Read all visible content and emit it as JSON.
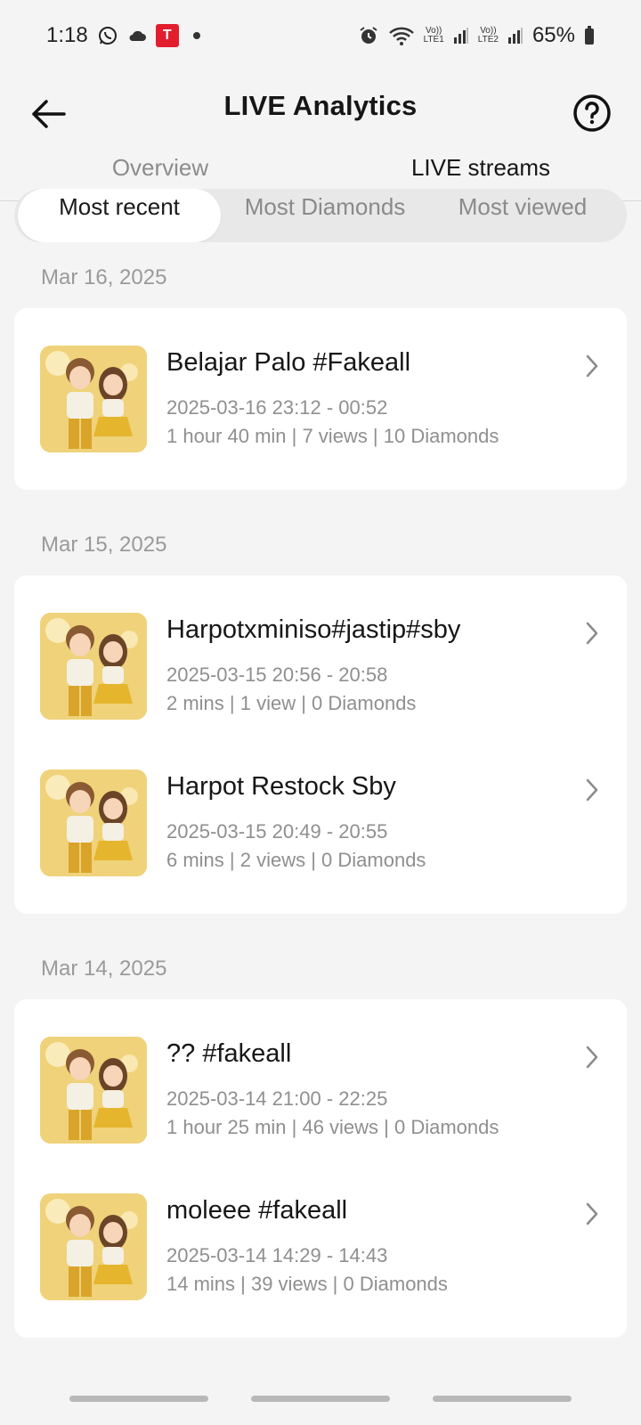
{
  "status_bar": {
    "time": "1:18",
    "battery": "65%",
    "sim1": "LTE1",
    "sim2": "LTE2",
    "volte": "Vo))"
  },
  "header": {
    "title": "LIVE Analytics"
  },
  "tabs": [
    {
      "label": "Overview",
      "active": false
    },
    {
      "label": "LIVE streams",
      "active": true
    }
  ],
  "sort_options": [
    {
      "label": "Most recent",
      "selected": true
    },
    {
      "label": "Most Diamonds",
      "selected": false
    },
    {
      "label": "Most viewed",
      "selected": false
    }
  ],
  "groups": [
    {
      "date": "Mar 16, 2025",
      "streams": [
        {
          "title": "Belajar Palo #Fakeall",
          "time": "2025-03-16 23:12 - 00:52",
          "stats": "1 hour 40 min | 7 views | 10 Diamonds"
        }
      ]
    },
    {
      "date": "Mar 15, 2025",
      "streams": [
        {
          "title": "Harpotxminiso#jastip#sby",
          "time": "2025-03-15 20:56 - 20:58",
          "stats": "2 mins | 1 view | 0 Diamonds"
        },
        {
          "title": "Harpot Restock Sby",
          "time": "2025-03-15 20:49 - 20:55",
          "stats": "6 mins | 2 views | 0 Diamonds"
        }
      ]
    },
    {
      "date": "Mar 14, 2025",
      "streams": [
        {
          "title": "?? #fakeall",
          "time": "2025-03-14 21:00 - 22:25",
          "stats": "1 hour 25 min | 46 views | 0 Diamonds"
        },
        {
          "title": "moleee #fakeall",
          "time": "2025-03-14 14:29 - 14:43",
          "stats": "14 mins | 39 views | 0 Diamonds"
        }
      ]
    }
  ]
}
